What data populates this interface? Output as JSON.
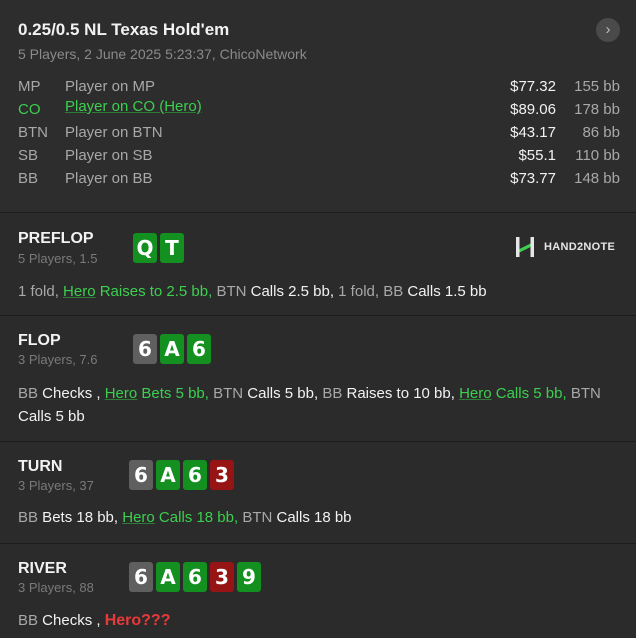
{
  "header": {
    "title": "0.25/0.5 NL Texas Hold'em",
    "subtitle": "5 Players, 2 June 2025 5:23:37, ChicoNetwork",
    "nav_icon": "chevron-right-icon"
  },
  "players": [
    {
      "pos": "MP",
      "name": "Player on MP",
      "stack": "$77.32",
      "bb": "155 bb"
    },
    {
      "pos": "CO",
      "name": "Player on CO (Hero)",
      "stack": "$89.06",
      "bb": "178 bb",
      "hero": true
    },
    {
      "pos": "BTN",
      "name": "Player on BTN",
      "stack": "$43.17",
      "bb": "86 bb"
    },
    {
      "pos": "SB",
      "name": "Player on SB",
      "stack": "$55.1",
      "bb": "110 bb"
    },
    {
      "pos": "BB",
      "name": "Player on BB",
      "stack": "$73.77",
      "bb": "148 bb"
    }
  ],
  "logo": {
    "text": "HAND2NOTE",
    "icon": "h2n-logo-icon"
  },
  "colors": {
    "hero": "#3ccf4f",
    "card_green": "#13901f",
    "card_grey": "#5f5f5f",
    "card_red": "#971414",
    "question": "#e83a3a"
  },
  "streets": {
    "preflop": {
      "name": "PREFLOP",
      "sub": "5 Players, 1.5",
      "cards": [
        "Q",
        "T"
      ],
      "a1": "1 fold, ",
      "a2_name": "Hero",
      "a2": " Raises to 2.5 bb, ",
      "a3_who": "BTN",
      "a3": " Calls 2.5 bb, ",
      "a4": "1 fold, ",
      "a5_who": "BB",
      "a5": " Calls 1.5 bb"
    },
    "flop": {
      "name": "FLOP",
      "sub": "3 Players, 7.6",
      "cards": [
        "6",
        "A",
        "6"
      ],
      "a1_who": "BB",
      "a1": " Checks , ",
      "a2_name": "Hero",
      "a2": " Bets 5 bb, ",
      "a3_who": "BTN",
      "a3": " Calls 5 bb, ",
      "a4_who": "BB",
      "a4": " Raises to 10 bb, ",
      "a5_name": "Hero",
      "a5": " Calls 5 bb, ",
      "a6_who": "BTN",
      "a6": " Calls 5 bb"
    },
    "turn": {
      "name": "TURN",
      "sub": "3 Players, 37",
      "cards": [
        "6",
        "A",
        "6",
        "3"
      ],
      "a1_who": "BB",
      "a1": " Bets 18 bb, ",
      "a2_name": "Hero",
      "a2": " Calls 18 bb, ",
      "a3_who": "BTN",
      "a3": " Calls 18 bb"
    },
    "river": {
      "name": "RIVER",
      "sub": "3 Players, 88",
      "cards": [
        "6",
        "A",
        "6",
        "3",
        "9"
      ],
      "a1_who": "BB",
      "a1": " Checks , ",
      "a2": "Hero???"
    }
  }
}
